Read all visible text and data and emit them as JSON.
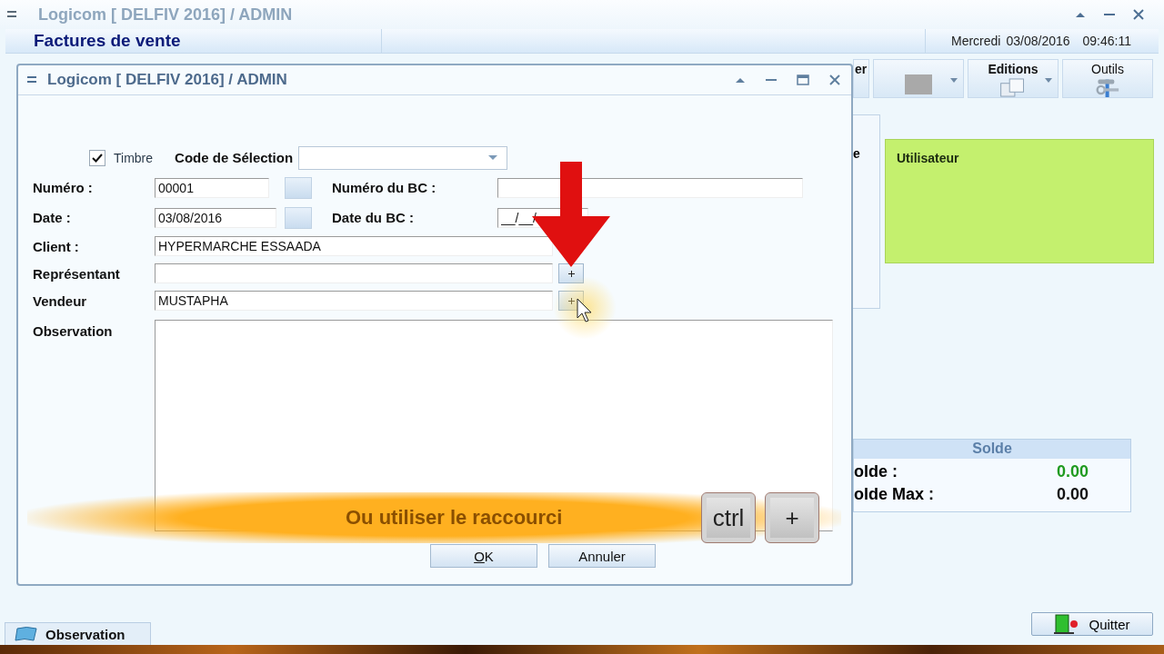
{
  "window": {
    "title": "Logicom   [ DELFIV 2016] /   ADMIN"
  },
  "header": {
    "title": "Factures de vente",
    "day": "Mercredi",
    "date": "03/08/2016",
    "time": "09:46:11"
  },
  "toolbar": [
    {
      "kind": "text",
      "label": "er"
    },
    {
      "kind": "swatch"
    },
    {
      "kind": "pages",
      "label": "Editions"
    },
    {
      "kind": "tools",
      "label": "Outils"
    }
  ],
  "side_fragment": "e",
  "user_panel": {
    "title": "Utilisateur"
  },
  "solde": {
    "title": "Solde",
    "rows": [
      {
        "label": "olde :",
        "value": "0.00",
        "color": "#1f9a1f"
      },
      {
        "label": "olde Max :",
        "value": "0.00",
        "color": "#111111"
      }
    ]
  },
  "dialog": {
    "title": "Logicom   [ DELFIV 2016] /   ADMIN",
    "timbre": {
      "label": "Timbre",
      "checked": true
    },
    "selection_code": {
      "label": "Code de Sélection"
    },
    "numero": {
      "label": "Numéro :",
      "value": "00001"
    },
    "numero_bc": {
      "label": "Numéro du BC :"
    },
    "date": {
      "label": "Date :",
      "value": "03/08/2016"
    },
    "date_bc": {
      "label": "Date du BC :",
      "value": "__/__/"
    },
    "client": {
      "label": "Client :",
      "value": "HYPERMARCHE ESSAADA"
    },
    "representant": {
      "label": "Représentant"
    },
    "vendeur": {
      "label": "Vendeur",
      "value": "MUSTAPHA"
    },
    "observation": {
      "label": "Observation"
    },
    "buttons": [
      "OK",
      "Annuler"
    ]
  },
  "overlay": {
    "caption": "Ou utiliser le raccourci",
    "keys": [
      "ctrl",
      "+"
    ]
  },
  "bottom": {
    "tab": "Observation",
    "quit": "Quitter"
  }
}
